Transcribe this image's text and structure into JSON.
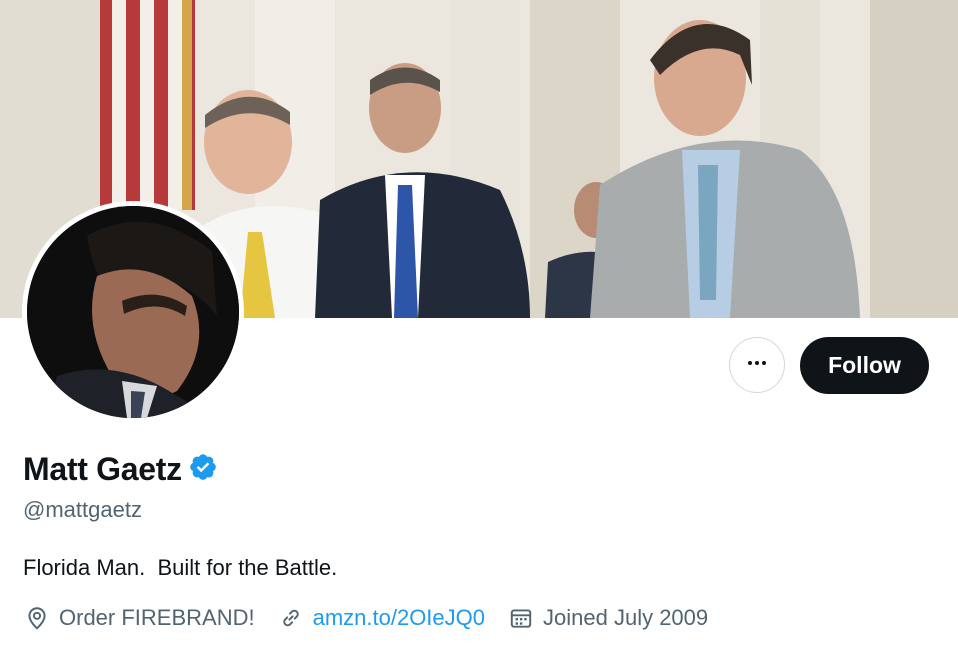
{
  "profile": {
    "display_name": "Matt Gaetz",
    "handle": "@mattgaetz",
    "bio": "Florida Man.  Built for the Battle.",
    "location": "Order FIREBRAND!",
    "website": "amzn.to/2OIeJQ0",
    "joined": "Joined July 2009"
  },
  "actions": {
    "more_label": "•••",
    "follow_label": "Follow"
  },
  "icons": {
    "verified": "verified-badge-icon",
    "location": "location-pin-icon",
    "link": "link-icon",
    "calendar": "calendar-icon",
    "more": "more-horizontal-icon"
  },
  "colors": {
    "accent": "#1d9bf0",
    "text_primary": "#0f1419",
    "text_secondary": "#536471",
    "button_dark": "#0f1419",
    "border": "#cfd9de"
  }
}
